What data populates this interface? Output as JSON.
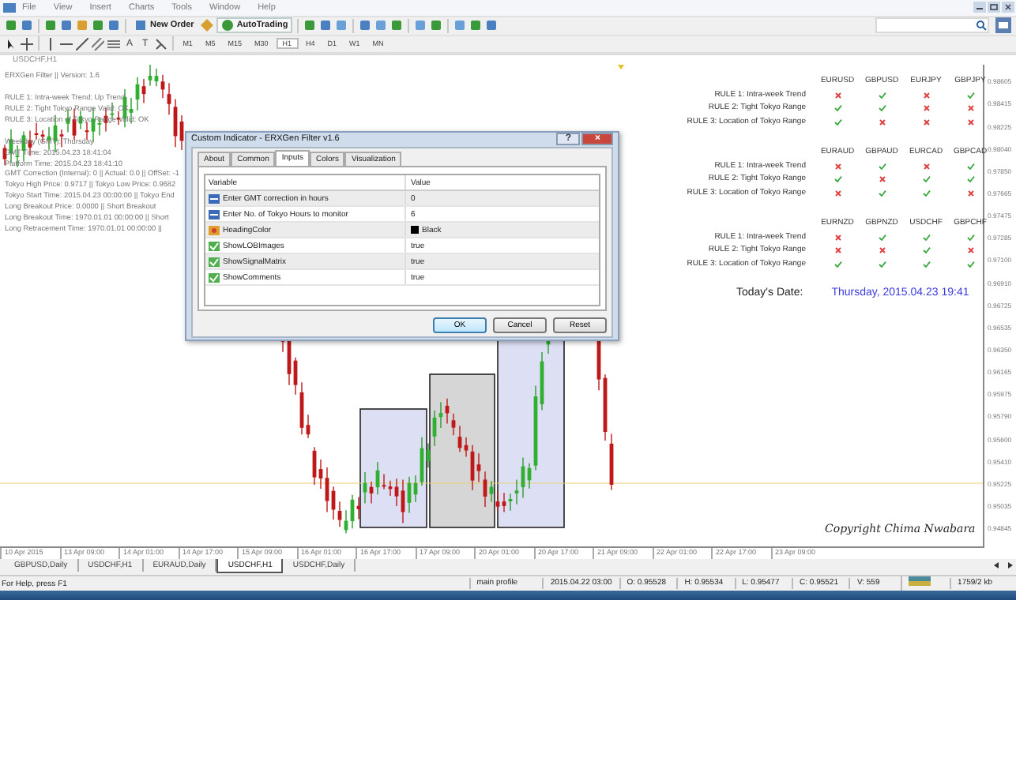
{
  "menu": [
    "File",
    "View",
    "Insert",
    "Charts",
    "Tools",
    "Window",
    "Help"
  ],
  "toolbar_buttons": [
    "New Order",
    "AutoTrading"
  ],
  "drawing_tools": [
    "A",
    "T"
  ],
  "timeframes": [
    {
      "label": "M1",
      "selected": false
    },
    {
      "label": "M5",
      "selected": false
    },
    {
      "label": "M15",
      "selected": false
    },
    {
      "label": "M30",
      "selected": false
    },
    {
      "label": "H1",
      "selected": true
    },
    {
      "label": "H4",
      "selected": false
    },
    {
      "label": "D1",
      "selected": false
    },
    {
      "label": "W1",
      "selected": false
    },
    {
      "label": "MN",
      "selected": false
    }
  ],
  "chart": {
    "title": "USDCHF,H1",
    "info_blocks": [
      [
        "ERXGen Filter || Version: 1.6"
      ],
      [
        "RULE 1: Intra-week Trend: Up Trend",
        "RULE 2: Tight Tokyo Range Valid: OK",
        "RULE 3: Location of Tokyo Range Valid: OK"
      ],
      [
        "Weekday (GMT): Thursday",
        "GMT Time: 2015.04.23 18:41:04",
        "Platform Time: 2015.04.23 18:41:10",
        "GMT Correction (Internal): 0 || Actual: 0.0 || OffSet: -1",
        "Tokyo High Price: 0.9717 || Tokyo Low Price: 0.9682",
        "Tokyo Start Time: 2015.04.23 00:00:00 || Tokyo End",
        "Long Breakout Price: 0.0000 || Short Breakout",
        "Long Breakout Time: 1970.01.01 00:00:00 || Short",
        "Long Retracement Time: 1970.01.01 00:00:00 ||"
      ]
    ],
    "price_axis": [
      "0.98605",
      "0.98415",
      "0.98225",
      "0.98040",
      "0.97850",
      "0.97665",
      "0.97475",
      "0.97285",
      "0.97100",
      "0.96910",
      "0.96725",
      "0.96535",
      "0.96350",
      "0.96165",
      "0.95975",
      "0.95790",
      "0.95600",
      "0.95410",
      "0.95225",
      "0.95035",
      "0.94845"
    ],
    "time_axis": [
      "10 Apr 2015",
      "13 Apr 09:00",
      "14 Apr 01:00",
      "14 Apr 17:00",
      "15 Apr 09:00",
      "16 Apr 01:00",
      "16 Apr 17:00",
      "17 Apr 09:00",
      "20 Apr 01:00",
      "20 Apr 17:00",
      "21 Apr 09:00",
      "22 Apr 01:00",
      "22 Apr 17:00",
      "23 Apr 09:00"
    ],
    "copyright": "Copyright Chima Nwabara"
  },
  "signal_matrix": {
    "groups": [
      {
        "pairs": [
          "EURUSD",
          "GBPUSD",
          "EURJPY",
          "GBPJPY"
        ],
        "rules": [
          {
            "label": "RULE 1: Intra-week Trend",
            "checks": [
              false,
              true,
              false,
              true
            ]
          },
          {
            "label": "RULE 2: Tight Tokyo Range",
            "checks": [
              true,
              true,
              false,
              false
            ]
          },
          {
            "label": "RULE 3: Location of Tokyo Range",
            "checks": [
              true,
              false,
              false,
              false
            ]
          }
        ]
      },
      {
        "pairs": [
          "EURAUD",
          "GBPAUD",
          "EURCAD",
          "GBPCAD"
        ],
        "rules": [
          {
            "label": "RULE 1: Intra-week Trend",
            "checks": [
              false,
              true,
              false,
              true
            ]
          },
          {
            "label": "RULE 2: Tight Tokyo Range",
            "checks": [
              true,
              false,
              true,
              true
            ]
          },
          {
            "label": "RULE 3: Location of Tokyo Range",
            "checks": [
              false,
              true,
              true,
              false
            ]
          }
        ]
      },
      {
        "pairs": [
          "EURNZD",
          "GBPNZD",
          "USDCHF",
          "GBPCHF"
        ],
        "rules": [
          {
            "label": "RULE 1: Intra-week Trend",
            "checks": [
              false,
              true,
              true,
              true
            ]
          },
          {
            "label": "RULE 2: Tight Tokyo Range",
            "checks": [
              false,
              false,
              true,
              false
            ]
          },
          {
            "label": "RULE 3: Location of Tokyo Range",
            "checks": [
              true,
              true,
              true,
              true
            ]
          }
        ]
      }
    ],
    "date_label": "Today's Date:",
    "date_value": "Thursday, 2015.04.23 19:41"
  },
  "dialog": {
    "title": "Custom Indicator - ERXGen Filter v1.6",
    "help": "?",
    "close": "×",
    "tabs": [
      {
        "label": "About",
        "selected": false
      },
      {
        "label": "Common",
        "selected": false
      },
      {
        "label": "Inputs",
        "selected": true
      },
      {
        "label": "Colors",
        "selected": false
      },
      {
        "label": "Visualization",
        "selected": false
      }
    ],
    "columns": [
      "Variable",
      "Value"
    ],
    "rows": [
      {
        "kind": "int",
        "variable": "Enter GMT correction in hours",
        "value": "0"
      },
      {
        "kind": "int",
        "variable": "Enter No. of Tokyo Hours to monitor",
        "value": "6"
      },
      {
        "kind": "color",
        "variable": "HeadingColor",
        "value": "Black",
        "color": "#000000"
      },
      {
        "kind": "bool",
        "variable": "ShowLOBImages",
        "value": "true"
      },
      {
        "kind": "bool",
        "variable": "ShowSignalMatrix",
        "value": "true"
      },
      {
        "kind": "bool",
        "variable": "ShowComments",
        "value": "true"
      }
    ],
    "buttons": [
      "OK",
      "Cancel",
      "Reset"
    ]
  },
  "chart_tabs": [
    {
      "label": "GBPUSD,Daily",
      "selected": false
    },
    {
      "label": "USDCHF,H1",
      "selected": false
    },
    {
      "label": "EURAUD,Daily",
      "selected": false
    },
    {
      "label": "USDCHF,H1",
      "selected": true
    },
    {
      "label": "USDCHF,Daily",
      "selected": false
    }
  ],
  "status_bar": {
    "help": "For Help, press F1",
    "profile": "main profile",
    "time": "2015.04.22 03:00",
    "open": "O: 0.95528",
    "high": "H: 0.95534",
    "low": "L: 0.95477",
    "close": "C: 0.95521",
    "volume": "V: 559",
    "traffic": "1759/2 kb"
  }
}
